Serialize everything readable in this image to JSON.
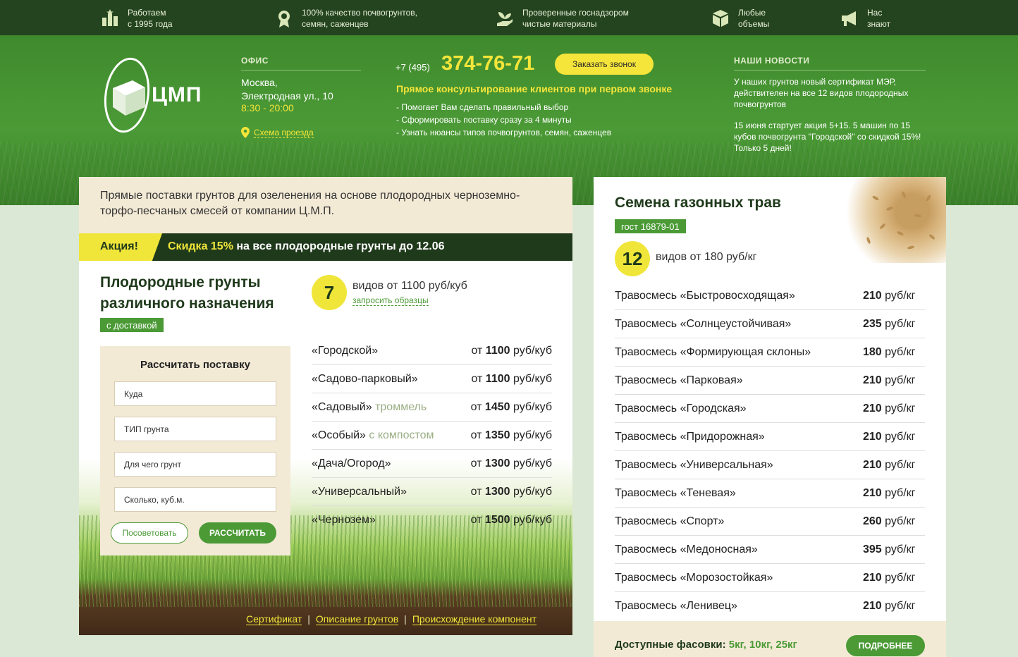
{
  "topbar": {
    "features": [
      {
        "icon": "trophy-icon",
        "line1": "Работаем",
        "line2": "с 1995 года"
      },
      {
        "icon": "award-medal-icon",
        "line1": "100% качество почвогрунтов,",
        "line2": "семян, саженцев"
      },
      {
        "icon": "hand-sprout-icon",
        "line1": "Проверенные госнадзором",
        "line2": "чистые материалы"
      },
      {
        "icon": "box-icon",
        "line1": "Любые",
        "line2": "объемы"
      },
      {
        "icon": "megaphone-icon",
        "line1": "Нас",
        "line2": "знают"
      }
    ]
  },
  "logo": {
    "text": "ЦМП"
  },
  "office": {
    "heading": "ОФИС",
    "city": "Москва,",
    "street": "Электродная ул., 10",
    "hours": "8:30 - 20:00",
    "map_link": "Схема проезда"
  },
  "contact": {
    "phone_prefix": "+7 (495)",
    "phone_number": "374-76-71",
    "call_button": "Заказать звонок",
    "consult_title": "Прямое консультирование клиентов при первом звонке",
    "bullets": [
      "- Помогает Вам сделать правильный выбор",
      "- Сформировать поставку сразу за 4 минуты",
      "- Узнать нюансы типов  почвогрунтов, семян, саженцев"
    ]
  },
  "news": {
    "heading": "НАШИ НОВОСТИ",
    "items": [
      "У наших грунтов новый сертификат МЭР, действителен на все 12 видов плодородных почвогрунтов",
      "15 июня стартует акция 5+15. 5 машин по 15 кубов почвогрунта \"Городской\" со скидкой 15%! Только 5 дней!"
    ]
  },
  "intro": {
    "text": "Прямые поставки грунтов для озеленения на основе плодородных черноземно-торфо-песчаных смесей от компании Ц.М.П."
  },
  "promo": {
    "tag": "Акция!",
    "highlight": "Скидка 15%",
    "rest": " на все плодородные грунты до 12.06"
  },
  "soils": {
    "title_line1": "Плодородные грунты",
    "title_line2": "различного назначения",
    "badge": "с доставкой",
    "count": "7",
    "count_text": "видов от 1100 руб/куб",
    "sample_link": "запросить образцы",
    "items": [
      {
        "name": "«Городской»",
        "note": "",
        "prefix": "от",
        "price": "1100",
        "unit": "руб/куб"
      },
      {
        "name": "«Садово-парковый»",
        "note": "",
        "prefix": "от",
        "price": "1100",
        "unit": "руб/куб"
      },
      {
        "name": "«Садовый»",
        "note": "троммель",
        "prefix": "от",
        "price": "1450",
        "unit": "руб/куб"
      },
      {
        "name": "«Особый»",
        "note": "с компостом",
        "prefix": "от",
        "price": "1350",
        "unit": "руб/куб"
      },
      {
        "name": "«Дача/Огород»",
        "note": "",
        "prefix": "от",
        "price": "1300",
        "unit": "руб/куб"
      },
      {
        "name": "«Универсальный»",
        "note": "",
        "prefix": "от",
        "price": "1300",
        "unit": "руб/куб"
      },
      {
        "name": "«Чернозем»",
        "note": "",
        "prefix": "от",
        "price": "1500",
        "unit": "руб/куб"
      }
    ],
    "links": [
      "Сертификат",
      "Описание грунтов",
      "Происхождение компонент"
    ],
    "link_separator": "|"
  },
  "calc": {
    "title": "Рассчитать поставку",
    "fields": [
      "Куда",
      "ТИП грунта",
      "Для чего грунт",
      "Сколько, куб.м."
    ],
    "advise_button": "Посоветовать",
    "calc_button": "РАССЧИТАТЬ"
  },
  "seeds": {
    "title": "Семена газонных трав",
    "badge": "гост 16879-01",
    "count": "12",
    "count_text": "видов от 180 руб/кг",
    "items": [
      {
        "name": "Травосмесь «Быстровосходящая»",
        "price": "210",
        "unit": "руб/кг"
      },
      {
        "name": "Травосмесь «Солнцеустойчивая»",
        "price": "235",
        "unit": "руб/кг"
      },
      {
        "name": "Травосмесь «Формирующая склоны»",
        "price": "180",
        "unit": "руб/кг"
      },
      {
        "name": "Травосмесь «Парковая»",
        "price": "210",
        "unit": "руб/кг"
      },
      {
        "name": "Травосмесь «Городская»",
        "price": "210",
        "unit": "руб/кг"
      },
      {
        "name": "Травосмесь «Придорожная»",
        "price": "210",
        "unit": "руб/кг"
      },
      {
        "name": "Травосмесь «Универсальная»",
        "price": "210",
        "unit": "руб/кг"
      },
      {
        "name": "Травосмесь «Теневая»",
        "price": "210",
        "unit": "руб/кг"
      },
      {
        "name": "Травосмесь «Спорт»",
        "price": "260",
        "unit": "руб/кг"
      },
      {
        "name": "Травосмесь «Медоносная»",
        "price": "395",
        "unit": "руб/кг"
      },
      {
        "name": "Травосмесь «Морозостойкая»",
        "price": "210",
        "unit": "руб/кг"
      },
      {
        "name": "Травосмесь «Ленивец»",
        "price": "210",
        "unit": "руб/кг"
      }
    ],
    "packs_label": "Доступные фасовки:",
    "packs_value": "5кг, 10кг, 25кг",
    "more_button": "ПОДРОБНЕЕ"
  },
  "colors": {
    "dark_green": "#24441f",
    "brand_green": "#4b9a36",
    "accent_yellow": "#f0e63a",
    "cream": "#f3ead6"
  }
}
